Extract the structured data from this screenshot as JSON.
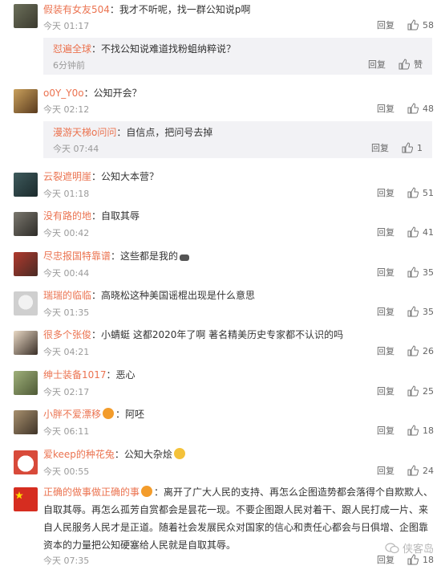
{
  "colors": {
    "name": "#eb7350",
    "meta": "#9a9a9a",
    "reply_bg": "#f2f2f5"
  },
  "comments": [
    {
      "name": "假装有女友504",
      "text": "：我才不听呢，找一群公知说p啊",
      "time": "今天 01:17",
      "reply_label": "回复",
      "likes": "58",
      "reply": {
        "name": "怼遍全球",
        "text": "：不找公知说难道找粉蛆纳粹说？",
        "time": "6分钟前",
        "reply_label": "回复",
        "likes": "赞"
      }
    },
    {
      "name": "o0Y_Y0o",
      "text": "：公知开会？",
      "time": "今天 02:12",
      "reply_label": "回复",
      "likes": "48",
      "reply": {
        "name": "漫游天梯o问问",
        "text": "：自信点，把问号去掉",
        "time": "今天 07:44",
        "reply_label": "回复",
        "likes": "1"
      }
    },
    {
      "name": "云裂遮明崖",
      "text": "：公知大本营？",
      "time": "今天 01:18",
      "reply_label": "回复",
      "likes": "51"
    },
    {
      "name": "没有路的地",
      "text": "：自取其辱",
      "time": "今天 00:42",
      "reply_label": "回复",
      "likes": "41"
    },
    {
      "name": "尽忠报国特靠谱",
      "text": "：这些都是我的",
      "time": "今天 00:44",
      "reply_label": "回复",
      "likes": "35"
    },
    {
      "name": "瑞瑞的临临",
      "text": "：高晓松这种美国谣棍出现是什么意思",
      "time": "今天 01:35",
      "reply_label": "回复",
      "likes": "35"
    },
    {
      "name": "很多个张俊",
      "text": "：小蜻蜓  这都2020年了啊  著名精美历史专家都不认识的吗",
      "time": "今天 04:21",
      "reply_label": "回复",
      "likes": "26"
    },
    {
      "name": "绅士装备1017",
      "text": "：恶心",
      "time": "今天 02:17",
      "reply_label": "回复",
      "likes": "25"
    },
    {
      "name": "小胖不爱漂移",
      "text": "：阿呸",
      "time": "今天 06:11",
      "reply_label": "回复",
      "likes": "18"
    },
    {
      "name": "爱keep的种花兔",
      "text": "：公知大杂烩",
      "time": "今天 00:55",
      "reply_label": "回复",
      "likes": "24"
    },
    {
      "name": "正确的做事做正确的事",
      "text": "：离开了广大人民的支持、再怎么企图造势都会落得个自欺欺人、自取其辱。再怎么孤芳自赏都会是昙花一现。不要企图跟人民对着干、跟人民打成一片、来自人民服务人民才是正道。随着社会发展民众对国家的信心和责任心都会与日俱增、企图靠资本的力量把公知硬塞给人民就是自取其辱。",
      "time": "今天 07:35",
      "reply_label": "回复",
      "likes": "18"
    }
  ],
  "watermark": "侠客岛"
}
